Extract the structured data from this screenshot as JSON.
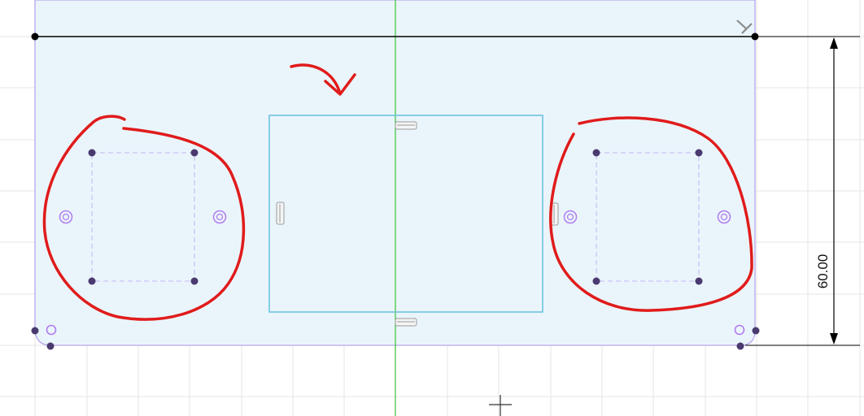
{
  "app": {
    "view": "sketch"
  },
  "dimension": {
    "value": "60.00",
    "orientation": "vertical"
  },
  "colors": {
    "background": "#ffffff",
    "grid": "#e6e6e6",
    "profile_fill": "#eaf5fb",
    "profile_edge": "#b8a6ef",
    "construction_line": "#000000",
    "center_axis": "#39c03a",
    "selected_rect": "#6ec3e0",
    "point": "#4a3a70",
    "annotation": "#e01b1b"
  },
  "icons": {
    "horizontal_constraint": "horizontal-constraint-icon",
    "vertical_constraint": "vertical-constraint-icon",
    "perpendicular_constraint": "perpendicular-constraint-icon",
    "center_point": "center-point-icon",
    "cursor": "crosshair-cursor-icon"
  }
}
